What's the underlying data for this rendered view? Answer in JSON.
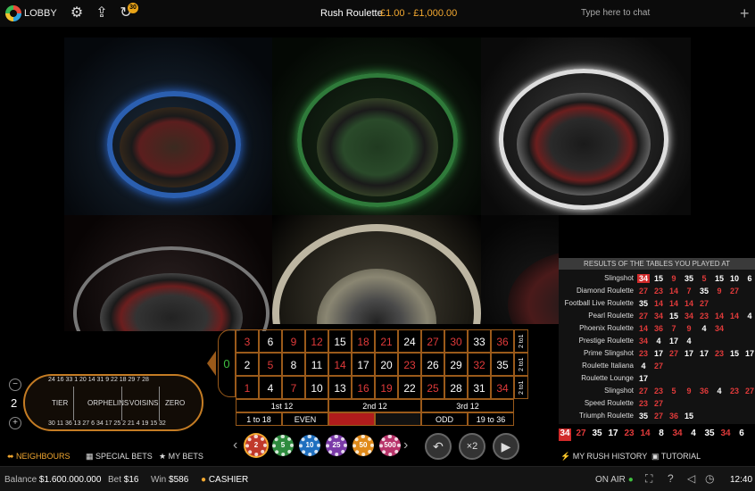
{
  "header": {
    "lobby_label": "LOBBY",
    "history_badge": "30",
    "game_title": "Rush Roulette",
    "bet_limits": "£1.00 - £1,000.00",
    "chat_placeholder": "Type here to chat"
  },
  "results": {
    "title": "RESULTS OF THE TABLES YOU PLAYED AT",
    "rows": [
      {
        "name": "Slingshot",
        "nums": [
          "34",
          "15",
          "9",
          "35",
          "5",
          "15",
          "10",
          "6"
        ]
      },
      {
        "name": "Diamond Roulette",
        "nums": [
          "27",
          "23",
          "14",
          "7",
          "35",
          "9",
          "27"
        ]
      },
      {
        "name": "Football Live Roulette",
        "nums": [
          "35",
          "14",
          "14",
          "14",
          "27"
        ]
      },
      {
        "name": "Pearl Roulette",
        "nums": [
          "27",
          "34",
          "15",
          "34",
          "23",
          "14",
          "14",
          "4"
        ]
      },
      {
        "name": "Phoenix Roulette",
        "nums": [
          "14",
          "36",
          "7",
          "9",
          "4",
          "34"
        ]
      },
      {
        "name": "Prestige Roulette",
        "nums": [
          "34",
          "4",
          "17",
          "4"
        ]
      },
      {
        "name": "Prime Slingshot",
        "nums": [
          "23",
          "17",
          "27",
          "17",
          "17",
          "23",
          "15",
          "17"
        ]
      },
      {
        "name": "Roulette Italiana",
        "nums": [
          "4",
          "27"
        ]
      },
      {
        "name": "Roulette Lounge",
        "nums": [
          "17"
        ]
      },
      {
        "name": "Slingshot",
        "nums": [
          "27",
          "23",
          "5",
          "9",
          "36",
          "4",
          "23",
          "27"
        ]
      },
      {
        "name": "Speed Roulette",
        "nums": [
          "23",
          "27"
        ]
      },
      {
        "name": "Triumph Roulette",
        "nums": [
          "35",
          "27",
          "36",
          "15"
        ]
      }
    ]
  },
  "history": [
    "34",
    "27",
    "35",
    "17",
    "23",
    "14",
    "8",
    "34",
    "4",
    "35",
    "34",
    "6"
  ],
  "betting_table": {
    "row_top": [
      "3",
      "6",
      "9",
      "12",
      "15",
      "18",
      "21",
      "24",
      "27",
      "30",
      "33",
      "36"
    ],
    "row_mid": [
      "2",
      "5",
      "8",
      "11",
      "14",
      "17",
      "20",
      "23",
      "26",
      "29",
      "32",
      "35"
    ],
    "row_bot": [
      "1",
      "4",
      "7",
      "10",
      "13",
      "16",
      "19",
      "22",
      "25",
      "28",
      "31",
      "34"
    ],
    "zero": "0",
    "column_bet": "2 to1",
    "dozens": [
      "1st 12",
      "2nd 12",
      "3rd 12"
    ],
    "outside": [
      "1 to 18",
      "EVEN",
      "",
      "ODD",
      "19 to 36"
    ]
  },
  "racetrack": {
    "neighbours_count": "2",
    "sections": [
      "TIER",
      "ORPHELINS",
      "VOISINS",
      "ZERO"
    ],
    "top_nums": "24 16 33 1 20 14 31 9 22 18 29 7 28",
    "bottom_nums": "30 11 36 13 27 6 34 17 25 2 21 4 19 15 32"
  },
  "chips": [
    "2",
    "5",
    "10",
    "25",
    "50",
    "500"
  ],
  "nav": {
    "neighbours": "NEIGHBOURS",
    "special_bets": "SPECIAL BETS",
    "my_bets": "MY BETS",
    "rush_history": "MY RUSH HISTORY",
    "tutorial": "TUTORIAL"
  },
  "footer": {
    "balance_label": "Balance",
    "balance_value": "$1.600.000.000",
    "bet_label": "Bet",
    "bet_value": "$16",
    "win_label": "Win",
    "win_value": "$586",
    "cashier": "CASHIER",
    "on_air": "ON AIR",
    "time": "12:40"
  },
  "colors": {
    "accent": "#f3a830",
    "red": "#e03a3a",
    "green": "#3fbf3f"
  }
}
